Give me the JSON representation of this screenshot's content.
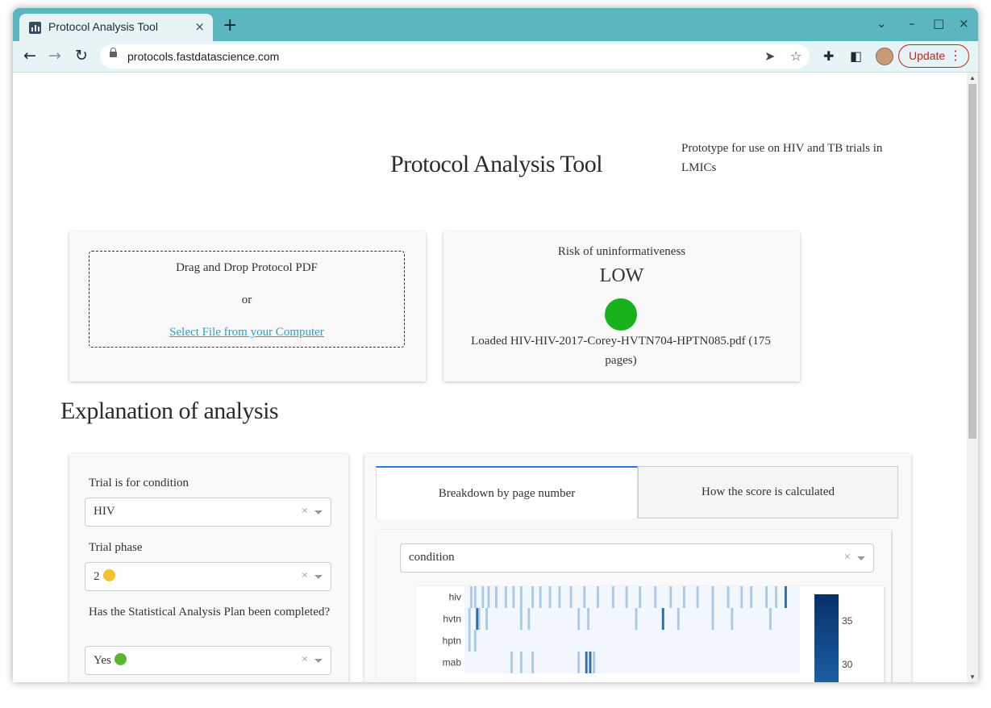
{
  "browser": {
    "tab_title": "Protocol Analysis Tool",
    "tab_close": "×",
    "new_tab": "+",
    "url": "protocols.fastdatascience.com",
    "update_label": "Update",
    "window_controls": {
      "dropdown": "⌄",
      "minimize": "–",
      "maximize": "□",
      "close": "×"
    }
  },
  "header": {
    "title": "Protocol Analysis Tool",
    "subtitle": "Prototype for use on HIV and TB trials in LMICs"
  },
  "upload": {
    "drag_text": "Drag and Drop Protocol PDF",
    "or_text": "or",
    "select_link": "Select File from your Computer"
  },
  "risk": {
    "label": "Risk of uninformativeness",
    "value": "LOW",
    "indicator_color": "#19b21c",
    "loaded_text": "Loaded HIV-HIV-2017-Corey-HVTN704-HPTN085.pdf (175 pages)"
  },
  "explanation": {
    "title": "Explanation of analysis",
    "fields": [
      {
        "label": "Trial is for condition",
        "value": "HIV",
        "emoji_color": ""
      },
      {
        "label": "Trial phase",
        "value": "2",
        "emoji_color": "#f2c12e"
      },
      {
        "label": "Has the Statistical Analysis Plan been completed?",
        "value": "Yes",
        "emoji_color": "#5cb531"
      }
    ],
    "clear_glyph": "×",
    "tabs": [
      {
        "label": "Breakdown by page number",
        "active": true
      },
      {
        "label": "How the score is calculated",
        "active": false
      }
    ],
    "breakdown_select": "condition"
  },
  "chart_data": {
    "type": "heatmap",
    "rows": [
      "hiv",
      "hvtn",
      "hptn",
      "mab"
    ],
    "x_range": [
      1,
      175
    ],
    "colorbar_ticks": [
      35,
      30
    ],
    "colorscale": "Blues",
    "highlight_pages": {
      "hiv": [
        4,
        6,
        10,
        13,
        17,
        22,
        26,
        30,
        36,
        40,
        45,
        50,
        56,
        63,
        70,
        78,
        85,
        92,
        100,
        108,
        115,
        122,
        130,
        138,
        145,
        150,
        158,
        163,
        168
      ],
      "hvtn": [
        3,
        8,
        12,
        30,
        34,
        60,
        65,
        90,
        104,
        112,
        130,
        140,
        160
      ],
      "hptn": [
        3,
        6
      ],
      "mab": [
        25,
        30,
        36,
        60,
        64,
        66,
        68
      ]
    },
    "strong_pages": {
      "hvtn": [
        7,
        104
      ],
      "hiv": [
        168
      ],
      "mab": [
        64,
        66
      ]
    }
  }
}
